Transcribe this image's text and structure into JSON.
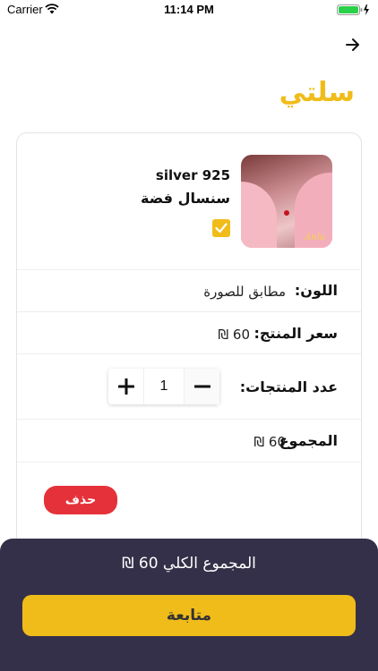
{
  "status_bar": {
    "carrier": "Carrier",
    "time": "11:14 PM"
  },
  "page": {
    "title": "سلتي"
  },
  "product": {
    "name_en": "silver 925",
    "name_ar": "سنسال فضة",
    "image_signature": "Anla",
    "selected": true
  },
  "details": {
    "color_label": "اللون:",
    "color_value": "مطابق للصورة",
    "price_label": "سعر المنتج:",
    "price_value": "60 ₪",
    "quantity_label": "عدد المنتجات:",
    "quantity_value": "1",
    "subtotal_label": "المجموع",
    "subtotal_value": "60 ₪"
  },
  "actions": {
    "delete_label": "حذف",
    "continue_label": "متابعة"
  },
  "footer": {
    "total_text": "المجموع الكلي 60 ₪"
  },
  "colors": {
    "accent": "#f0bc1a",
    "panel": "#353049",
    "danger": "#e5323a"
  },
  "icons": [
    "wifi-icon",
    "battery-icon",
    "arrow-right-icon",
    "checkmark-icon",
    "plus-icon",
    "minus-icon"
  ]
}
